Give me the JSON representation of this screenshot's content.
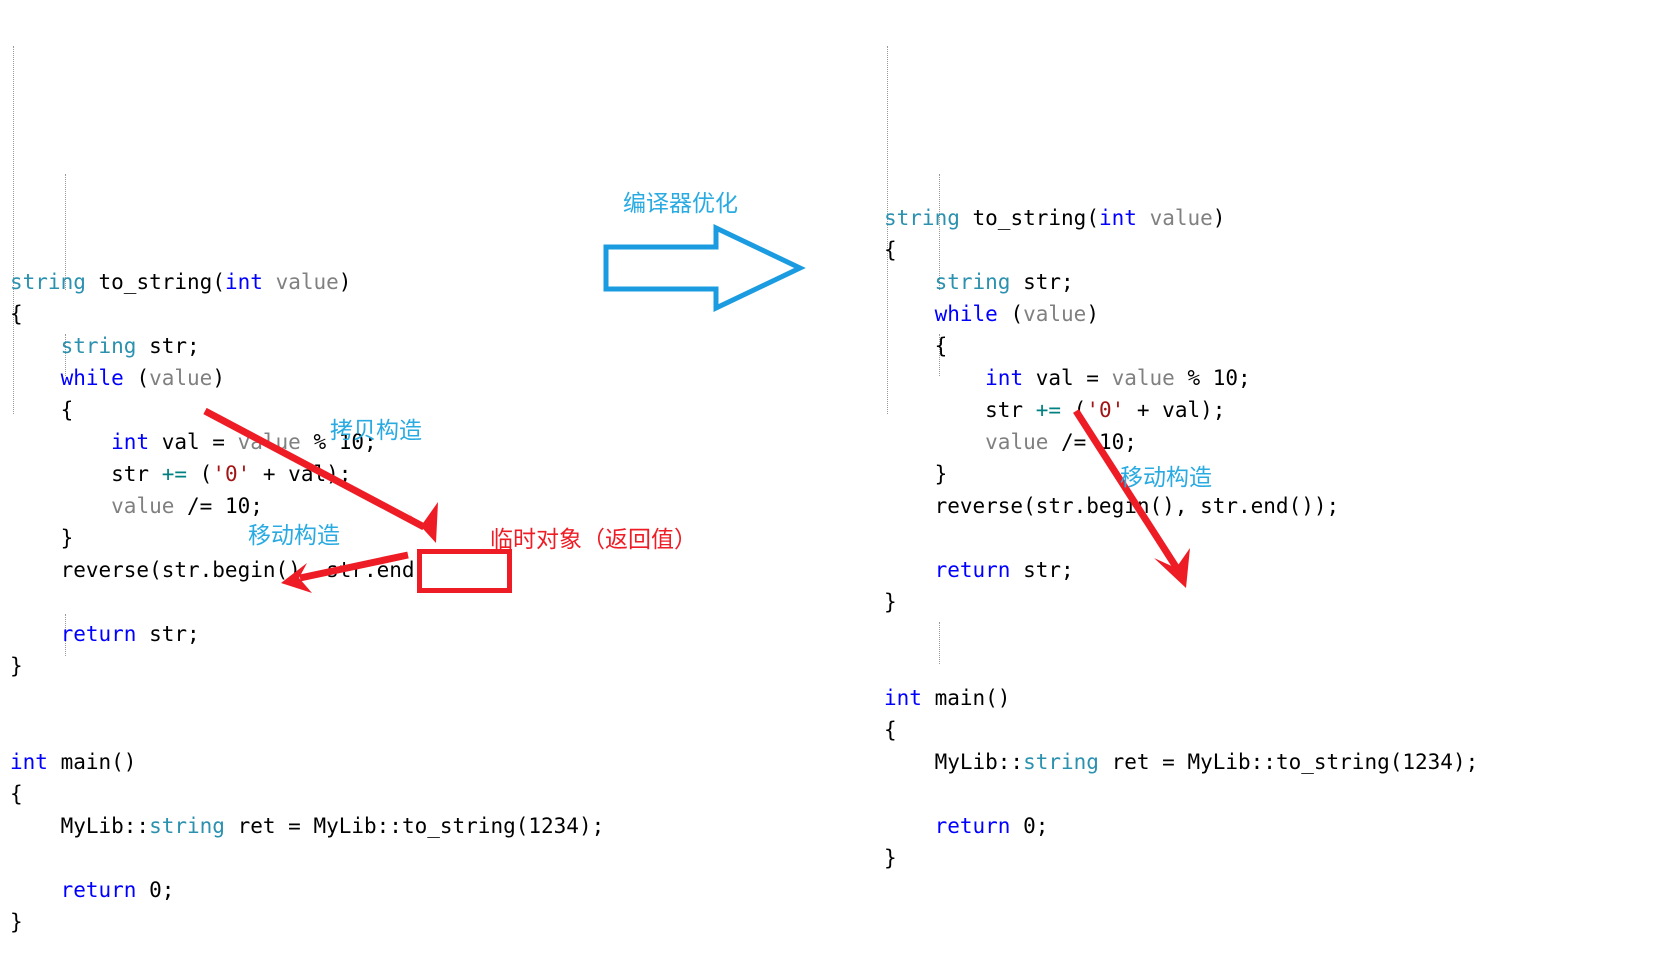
{
  "panels": {
    "left": {
      "name": "before-optimization-code",
      "lines": [
        [
          {
            "t": "string ",
            "c": "type"
          },
          {
            "t": "to_string",
            "c": "plain"
          },
          {
            "t": "(",
            "c": "plain"
          },
          {
            "t": "int",
            "c": "kw"
          },
          {
            "t": " ",
            "c": "plain"
          },
          {
            "t": "value",
            "c": "var"
          },
          {
            "t": ")",
            "c": "plain"
          }
        ],
        [
          {
            "t": "{",
            "c": "plain"
          }
        ],
        [
          {
            "t": "    ",
            "c": "plain"
          },
          {
            "t": "string",
            "c": "type"
          },
          {
            "t": " str;",
            "c": "plain"
          }
        ],
        [
          {
            "t": "    ",
            "c": "plain"
          },
          {
            "t": "while",
            "c": "kw"
          },
          {
            "t": " (",
            "c": "plain"
          },
          {
            "t": "value",
            "c": "var"
          },
          {
            "t": ")",
            "c": "plain"
          }
        ],
        [
          {
            "t": "    {",
            "c": "plain"
          }
        ],
        [
          {
            "t": "        ",
            "c": "plain"
          },
          {
            "t": "int",
            "c": "kw"
          },
          {
            "t": " val = ",
            "c": "plain"
          },
          {
            "t": "value",
            "c": "var"
          },
          {
            "t": " % 10;",
            "c": "plain"
          }
        ],
        [
          {
            "t": "        str ",
            "c": "plain"
          },
          {
            "t": "+=",
            "c": "op"
          },
          {
            "t": " (",
            "c": "plain"
          },
          {
            "t": "'0'",
            "c": "char"
          },
          {
            "t": " + val);",
            "c": "plain"
          }
        ],
        [
          {
            "t": "        ",
            "c": "plain"
          },
          {
            "t": "value",
            "c": "var"
          },
          {
            "t": " /= 10;",
            "c": "plain"
          }
        ],
        [
          {
            "t": "    }",
            "c": "plain"
          }
        ],
        [
          {
            "t": "    reverse(str.begin(), str.end());",
            "c": "plain"
          }
        ],
        [],
        [
          {
            "t": "    ",
            "c": "plain"
          },
          {
            "t": "return",
            "c": "kw"
          },
          {
            "t": " str;",
            "c": "plain"
          }
        ],
        [
          {
            "t": "}",
            "c": "plain"
          }
        ],
        [],
        [],
        [
          {
            "t": "int",
            "c": "kw"
          },
          {
            "t": " main()",
            "c": "plain"
          }
        ],
        [
          {
            "t": "{",
            "c": "plain"
          }
        ],
        [
          {
            "t": "    MyLib::",
            "c": "plain"
          },
          {
            "t": "string",
            "c": "type"
          },
          {
            "t": " ret = MyLib::to_string(1234);",
            "c": "plain"
          }
        ],
        [],
        [
          {
            "t": "    ",
            "c": "plain"
          },
          {
            "t": "return",
            "c": "kw"
          },
          {
            "t": " 0;",
            "c": "plain"
          }
        ],
        [
          {
            "t": "}",
            "c": "plain"
          }
        ]
      ]
    },
    "right": {
      "name": "after-optimization-code",
      "lines": [
        [
          {
            "t": "string ",
            "c": "type"
          },
          {
            "t": "to_string",
            "c": "plain"
          },
          {
            "t": "(",
            "c": "plain"
          },
          {
            "t": "int",
            "c": "kw"
          },
          {
            "t": " ",
            "c": "plain"
          },
          {
            "t": "value",
            "c": "var"
          },
          {
            "t": ")",
            "c": "plain"
          }
        ],
        [
          {
            "t": "{",
            "c": "plain"
          }
        ],
        [
          {
            "t": "    ",
            "c": "plain"
          },
          {
            "t": "string",
            "c": "type"
          },
          {
            "t": " str;",
            "c": "plain"
          }
        ],
        [
          {
            "t": "    ",
            "c": "plain"
          },
          {
            "t": "while",
            "c": "kw"
          },
          {
            "t": " (",
            "c": "plain"
          },
          {
            "t": "value",
            "c": "var"
          },
          {
            "t": ")",
            "c": "plain"
          }
        ],
        [
          {
            "t": "    {",
            "c": "plain"
          }
        ],
        [
          {
            "t": "        ",
            "c": "plain"
          },
          {
            "t": "int",
            "c": "kw"
          },
          {
            "t": " val = ",
            "c": "plain"
          },
          {
            "t": "value",
            "c": "var"
          },
          {
            "t": " % 10;",
            "c": "plain"
          }
        ],
        [
          {
            "t": "        str ",
            "c": "plain"
          },
          {
            "t": "+=",
            "c": "op"
          },
          {
            "t": " (",
            "c": "plain"
          },
          {
            "t": "'0'",
            "c": "char"
          },
          {
            "t": " + val);",
            "c": "plain"
          }
        ],
        [
          {
            "t": "        ",
            "c": "plain"
          },
          {
            "t": "value",
            "c": "var"
          },
          {
            "t": " /= 10;",
            "c": "plain"
          }
        ],
        [
          {
            "t": "    }",
            "c": "plain"
          }
        ],
        [
          {
            "t": "    reverse(str.begin(), str.end());",
            "c": "plain"
          }
        ],
        [],
        [
          {
            "t": "    ",
            "c": "plain"
          },
          {
            "t": "return",
            "c": "kw"
          },
          {
            "t": " str;",
            "c": "plain"
          }
        ],
        [
          {
            "t": "}",
            "c": "plain"
          }
        ],
        [],
        [],
        [
          {
            "t": "int",
            "c": "kw"
          },
          {
            "t": " main()",
            "c": "plain"
          }
        ],
        [
          {
            "t": "{",
            "c": "plain"
          }
        ],
        [
          {
            "t": "    MyLib::",
            "c": "plain"
          },
          {
            "t": "string",
            "c": "type"
          },
          {
            "t": " ret = MyLib::to_string(1234);",
            "c": "plain"
          }
        ],
        [],
        [
          {
            "t": "    ",
            "c": "plain"
          },
          {
            "t": "return",
            "c": "kw"
          },
          {
            "t": " 0;",
            "c": "plain"
          }
        ],
        [
          {
            "t": "}",
            "c": "plain"
          }
        ]
      ]
    }
  },
  "annotations": {
    "compiler_opt_label": "编译器优化",
    "copy_ctor_label": "拷贝构造",
    "move_ctor_label_left": "移动构造",
    "move_ctor_label_right": "移动构造",
    "temp_object_label": "临时对象（返回值）"
  },
  "colors": {
    "accent_blue": "#29abe2",
    "accent_red": "#ee1c25",
    "keyword_blue": "#0000ff",
    "type_teal": "#2b91af",
    "var_grey": "#808080",
    "operator_teal": "#008080",
    "char_darkred": "#a31515"
  }
}
